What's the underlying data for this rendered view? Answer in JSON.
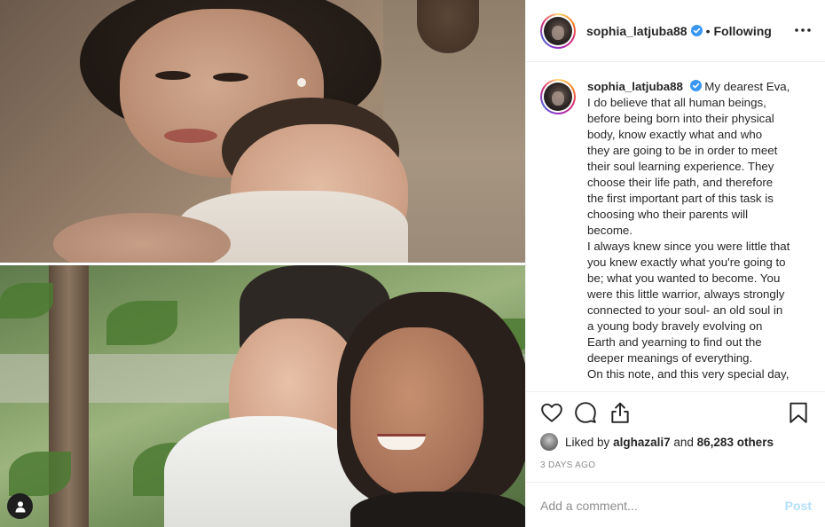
{
  "post": {
    "author": "sophia_latjuba88",
    "follow_status": "Following",
    "separator": "•"
  },
  "caption": {
    "author": "sophia_latjuba88",
    "first_line_after_name": "My dearest Eva,",
    "lines": [
      "I do believe that all human beings,",
      "before being born into their physical",
      "body, know exactly what and who",
      "they are going to be in order to meet",
      "their soul learning experience. They",
      "choose their life path, and therefore",
      "the first important part of this task is",
      "choosing who their parents will",
      "become.",
      "I always knew since you were little that",
      "you knew exactly what you're going to",
      "be; what you wanted to become. You",
      "were this little warrior, always strongly",
      "connected to your soul- an old soul in",
      "a young body bravely evolving on",
      "Earth and yearning to find out the",
      "deeper meanings of everything.",
      "On this note, and this very special day,"
    ]
  },
  "likes": {
    "prefix": "Liked by",
    "liker": "alghazali7",
    "middle": "and",
    "others": "86,283 others"
  },
  "timestamp": "3 DAYS AGO",
  "comment": {
    "placeholder": "Add a comment...",
    "post_label": "Post"
  },
  "icons": {
    "verified": "verified-badge-icon",
    "more": "more-options-icon",
    "like": "heart-icon",
    "comment": "comment-bubble-icon",
    "share": "share-icon",
    "save": "bookmark-icon",
    "user_tags": "user-tag-icon"
  },
  "colors": {
    "verified_blue": "#3897f0",
    "post_button_disabled": "#b2dffc",
    "muted_text": "#8e8e8e",
    "border": "#efefef"
  }
}
